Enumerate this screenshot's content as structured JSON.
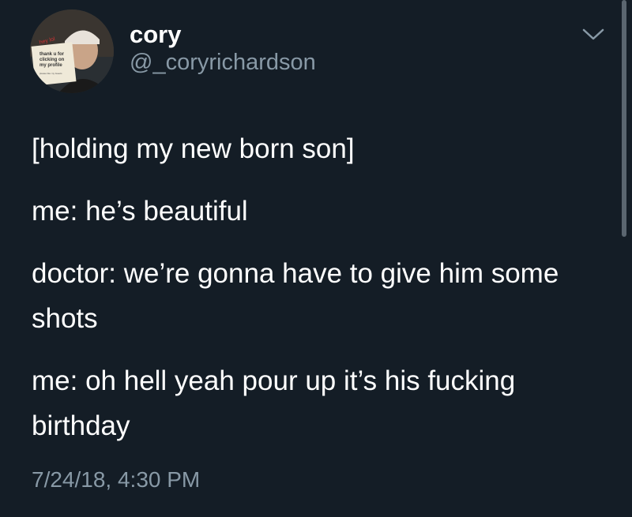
{
  "tweet": {
    "author": {
      "display_name": "cory",
      "handle": "@_coryrichardson",
      "avatar": {
        "sign_top": "hey lol",
        "sign_line1": "thank u for",
        "sign_line2": "clicking on",
        "sign_line3": "my profile",
        "sign_small": "please like my tweets"
      }
    },
    "menu_icon": "chevron-down-icon",
    "lines": [
      "[holding my new born son]",
      "me: he’s beautiful",
      "doctor: we’re gonna have to give him some shots",
      "me: oh hell yeah pour up it’s his fucking birthday"
    ],
    "timestamp": "7/24/18, 4:30 PM"
  },
  "colors": {
    "background": "#141d26",
    "primary_text": "#ffffff",
    "secondary_text": "#8899a6"
  }
}
